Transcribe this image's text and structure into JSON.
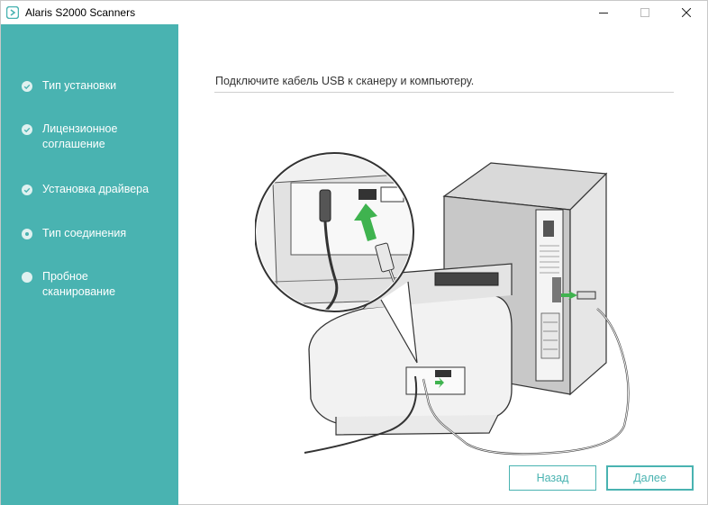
{
  "window": {
    "title": "Alaris S2000 Scanners",
    "controls": [
      "minimize-icon",
      "maximize-icon",
      "close-icon"
    ]
  },
  "colors": {
    "accent": "#49b3b1",
    "step_dot": "#dff1f0",
    "check": "#49b3b1"
  },
  "steps": [
    {
      "label": "Тип установки",
      "state": "completed",
      "icon": "check-icon"
    },
    {
      "label": "Лицензионное соглашение",
      "state": "completed",
      "icon": "check-icon"
    },
    {
      "label": "Установка драйвера",
      "state": "completed",
      "icon": "check-icon"
    },
    {
      "label": "Тип соединения",
      "state": "current",
      "icon": "current-step-dot-icon"
    },
    {
      "label": "Пробное сканирование",
      "state": "pending",
      "icon": "pending-step-dot-icon"
    }
  ],
  "main": {
    "instruction": "Подключите кабель USB к сканеру и компьютеру.",
    "illustration": "usb-connection-illustration"
  },
  "buttons": {
    "back_label": "Назад",
    "next_label": "Далее"
  }
}
